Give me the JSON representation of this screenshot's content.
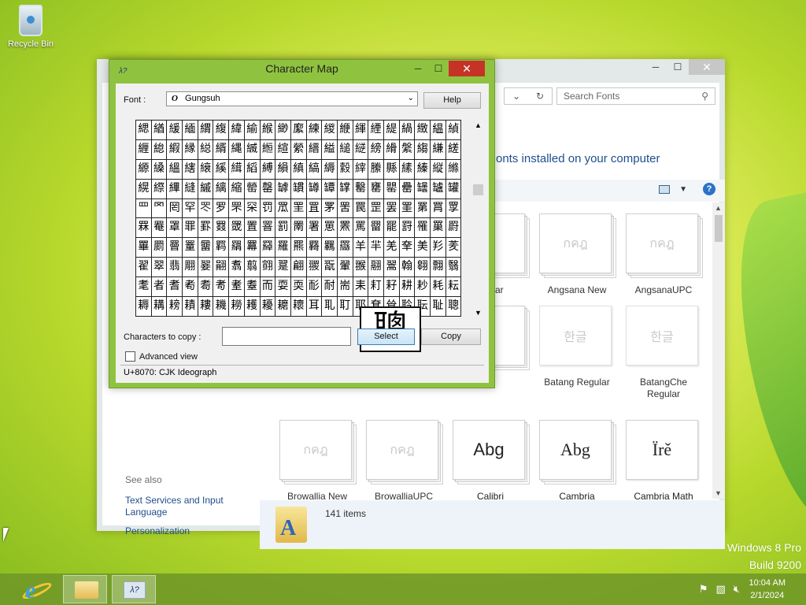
{
  "desktop": {
    "recycle_bin_label": "Recycle Bin",
    "watermark_line1": "Windows 8 Pro",
    "watermark_line2": "Build 9200"
  },
  "explorer": {
    "search_placeholder": "Search Fonts",
    "heading_partial": "onts installed on your computer",
    "see_also_header": "See also",
    "see_also_links": [
      "Text Services and Input Language",
      "Personalization"
    ],
    "status_count": "141 items",
    "fonts": [
      {
        "name": "egular",
        "preview": ""
      },
      {
        "name": "Angsana New",
        "preview": "กคฎ"
      },
      {
        "name": "AngsanaUPC",
        "preview": "กคฎ"
      },
      {
        "name": "",
        "preview": "g"
      },
      {
        "name": "Batang Regular",
        "preview": "한글"
      },
      {
        "name": "BatangChe Regular",
        "preview": "한글"
      },
      {
        "name": "Browallia New",
        "preview": "กคฎ"
      },
      {
        "name": "BrowalliaUPC",
        "preview": "กคฎ"
      },
      {
        "name": "Calibri",
        "preview": "Abg"
      },
      {
        "name": "Cambria",
        "preview": "Abg"
      },
      {
        "name": "Cambria Math",
        "preview": "Ïrě"
      }
    ]
  },
  "charmap": {
    "title": "Character Map",
    "font_label": "Font :",
    "font_value": "Gungsuh",
    "help_label": "Help",
    "chars_to_copy_label": "Characters to copy :",
    "chars_to_copy_value": "",
    "select_label": "Select",
    "copy_label": "Copy",
    "advanced_view_label": "Advanced view",
    "status": "U+8070: CJK Ideograph",
    "zoomed_char": "聰",
    "grid_rows": [
      "緦緧緩緬緭緮緯緰緱緲緳練緵緶緷緸緹緺緻緼緽",
      "緾緿縀縁縂縃縄縅縆縇縈縉縊縋縌縍縎縏縐縑縒",
      "縓縔縕縖縗縘縙縚縛縜縝縞縟縠縡縢縣縤縥縦縧",
      "縨縩縪縫縬縭縮罃罄罅罆罇罈罉罊罋罌罍罎罏罐",
      "罒罓罔罕罖罗罘罙罚罛罜罝罞罟罠罡罢罣罤罥罦",
      "罧罨罩罪罫罬罭置罯罰罱署罳罴罵罶罷罸罹罺罻",
      "罼罽罾罿羀羁羂羃羄羅羆羇羈羉羊羋羌羍美羏羐",
      "翟翠翡翢翣翤翥翦翧翨翩翪翫翬翭翮翯翰翱翲翳",
      "耄者耆耇耈耉耊耋而耍耎耏耐耑耒耓耔耕耖耗耘",
      "耨耩耪耫耬耭耮耯耰耱耲耳耴耵耶耷耸耹耺耻聰"
    ]
  },
  "taskbar": {
    "time": "10:04 AM",
    "date": "2/1/2024"
  }
}
